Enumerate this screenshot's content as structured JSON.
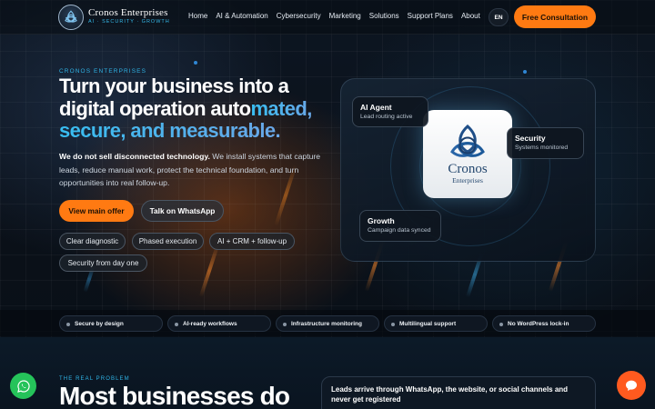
{
  "header": {
    "brand_name": "Cronos Enterprises",
    "brand_tagline": "AI · SECURITY · GROWTH",
    "nav": [
      "Home",
      "AI & Automation",
      "Cybersecurity",
      "Marketing",
      "Solutions",
      "Support Plans",
      "About"
    ],
    "language": "EN",
    "cta": "Free Consultation"
  },
  "hero": {
    "eyebrow": "CRONOS ENTERPRISES",
    "title_line1": "Turn your business into a",
    "title_line2_a": "digital operation auto",
    "title_line2_b": "mated,",
    "title_line3": "secure, and measurable.",
    "lead_bold": "We do not sell disconnected technology.",
    "lead_rest": " We install systems that capture leads, reduce manual work, protect the technical foundation, and turn opportunities into real follow-up.",
    "primary_button": "View main offer",
    "secondary_button": "Talk on WhatsApp",
    "chips": [
      "Clear diagnostic",
      "Phased execution",
      "AI + CRM + follow-up",
      "Security from day one"
    ]
  },
  "visual": {
    "logo_name": "Cronos",
    "logo_sub": "Enterprises",
    "badges": [
      {
        "title": "AI Agent",
        "subtitle": "Lead routing active"
      },
      {
        "title": "Security",
        "subtitle": "Systems monitored"
      },
      {
        "title": "Growth",
        "subtitle": "Campaign data synced"
      }
    ]
  },
  "features": [
    "Secure by design",
    "AI-ready workflows",
    "Infrastructure monitoring",
    "Multilingual support",
    "No WordPress lock-in"
  ],
  "problem": {
    "eyebrow": "THE REAL PROBLEM",
    "title": "Most businesses do",
    "card_text": "Leads arrive through WhatsApp, the website, or social channels and never get registered"
  },
  "colors": {
    "accent_orange": "#ff7a12",
    "accent_cyan": "#2fb3e6",
    "whatsapp_green": "#25c35a",
    "chat_orange": "#ff5a1f"
  },
  "icons": {
    "brand": "triquetra-logo-icon",
    "whatsapp": "whatsapp-icon",
    "chat": "chat-bubble-icon"
  }
}
